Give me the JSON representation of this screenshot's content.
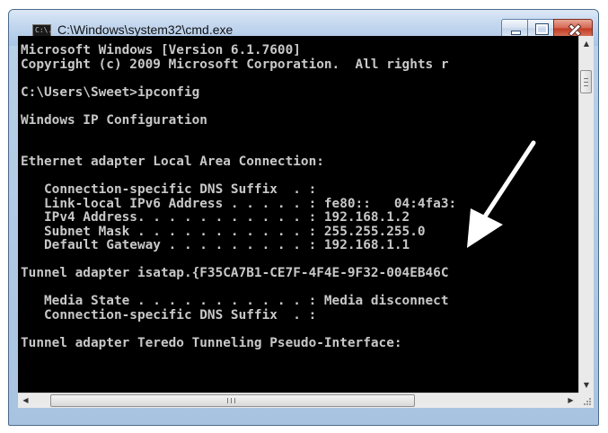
{
  "window": {
    "title": "C:\\Windows\\system32\\cmd.exe",
    "icon_text": "C:\\.",
    "icon": "cmd-icon"
  },
  "caption_buttons": {
    "minimize_icon": "minimize-icon",
    "maximize_icon": "maximize-icon",
    "close_icon": "close-icon"
  },
  "console": {
    "background": "#000000",
    "foreground": "#c8c8c8",
    "lines": [
      "Microsoft Windows [Version 6.1.7600]",
      "Copyright (c) 2009 Microsoft Corporation.  All rights r",
      "",
      "C:\\Users\\Sweet>ipconfig",
      "",
      "Windows IP Configuration",
      "",
      "",
      "Ethernet adapter Local Area Connection:",
      "",
      "   Connection-specific DNS Suffix  . :",
      "   Link-local IPv6 Address . . . . . : fe80::   04:4fa3:",
      "   IPv4 Address. . . . . . . . . . . : 192.168.1.2",
      "   Subnet Mask . . . . . . . . . . . : 255.255.255.0",
      "   Default Gateway . . . . . . . . . : 192.168.1.1",
      "",
      "Tunnel adapter isatap.{F35CA7B1-CE7F-4F4E-9F32-004EB46C",
      "",
      "   Media State . . . . . . . . . . . : Media disconnect",
      "   Connection-specific DNS Suffix  . :",
      "",
      "Tunnel adapter Teredo Tunneling Pseudo-Interface:"
    ]
  },
  "scrollbars": {
    "up_icon": "scroll-up-icon",
    "down_icon": "scroll-down-icon",
    "left_icon": "scroll-left-icon",
    "right_icon": "scroll-right-icon"
  },
  "annotation": {
    "arrow_color": "#ffffff"
  }
}
